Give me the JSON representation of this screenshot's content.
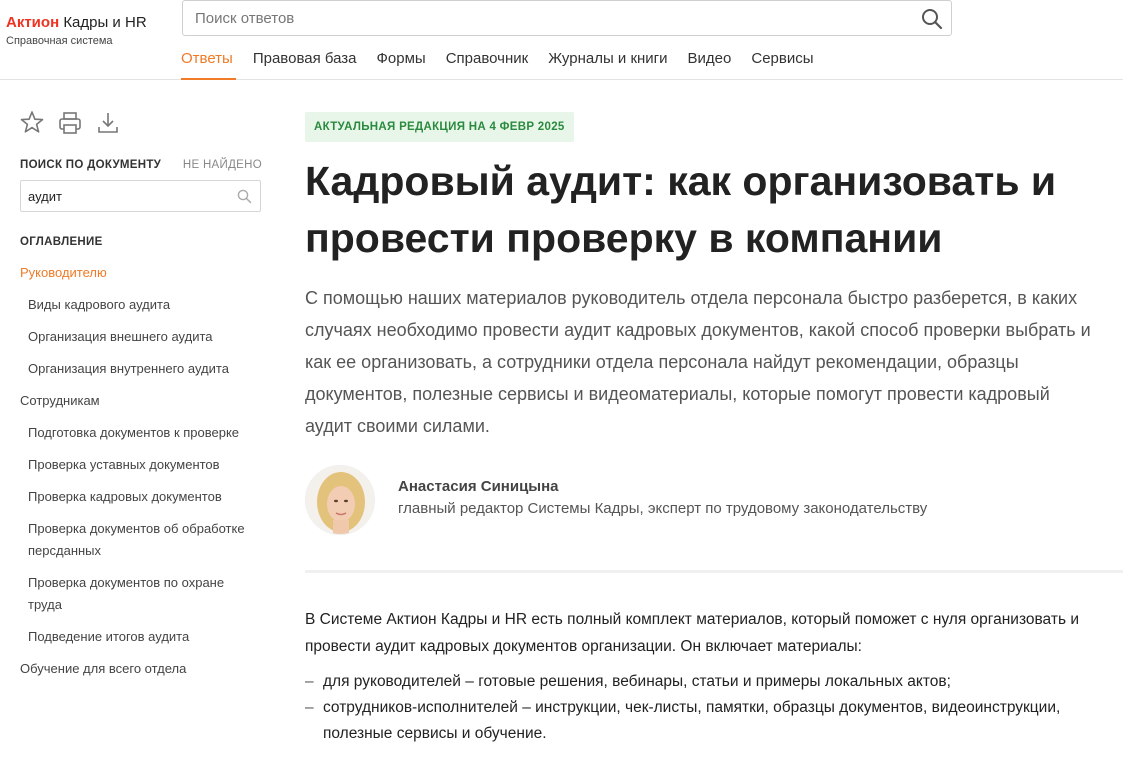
{
  "header": {
    "logo": {
      "brand": "Актион",
      "product": "Кадры и HR",
      "subtitle": "Справочная система"
    },
    "search_placeholder": "Поиск ответов",
    "nav": [
      "Ответы",
      "Правовая база",
      "Формы",
      "Справочник",
      "Журналы и книги",
      "Видео",
      "Сервисы"
    ]
  },
  "sidebar": {
    "doc_search_title": "ПОИСК ПО ДОКУМЕНТУ",
    "not_found": "НЕ НАЙДЕНО",
    "doc_search_value": "аудит",
    "toc_title": "ОГЛАВЛЕНИЕ",
    "toc": [
      {
        "label": "Руководителю",
        "level": 1,
        "active": true
      },
      {
        "label": "Виды кадрового аудита",
        "level": 2
      },
      {
        "label": "Организация внешнего аудита",
        "level": 2
      },
      {
        "label": "Организация внутреннего аудита",
        "level": 2
      },
      {
        "label": "Сотрудникам",
        "level": 1
      },
      {
        "label": "Подготовка документов к проверке",
        "level": 2
      },
      {
        "label": "Проверка уставных документов",
        "level": 2
      },
      {
        "label": "Проверка кадровых документов",
        "level": 2
      },
      {
        "label": "Проверка документов об обработке персданных",
        "level": 2
      },
      {
        "label": "Проверка документов по охране труда",
        "level": 2
      },
      {
        "label": "Подведение итогов аудита",
        "level": 2
      },
      {
        "label": "Обучение для всего отдела",
        "level": 1
      }
    ]
  },
  "main": {
    "badge": "АКТУАЛЬНАЯ РЕДАКЦИЯ НА 4 ФЕВР 2025",
    "title": "Кадровый аудит: как организовать и провести проверку в компании",
    "lead": "С помощью наших материалов руководитель отдела персонала быстро разберется, в каких случаях необходимо провести аудит кадровых документов, какой способ проверки выбрать и как ее организовать, а сотрудники отдела персонала найдут рекомендации, образцы документов, полезные сервисы и видеоматериалы, которые помогут провести кадровый аудит своими силами.",
    "author_name": "Анастасия Синицына",
    "author_role": "главный редактор Системы Кадры, эксперт по трудовому законодательству",
    "body": "В Системе Актион Кадры и HR есть полный комплект материалов, который поможет с нуля организовать и провести аудит кадровых документов организации. Он включает материалы:",
    "list": [
      "для руководителей – готовые решения, вебинары, статьи и примеры локальных актов;",
      "сотрудников-исполнителей – инструкции, чек-листы, памятки, образцы документов, видеоинструкции, полезные сервисы и обучение."
    ]
  },
  "colors": {
    "accent": "#f07a26",
    "brand": "#e32222",
    "badge_bg": "#e8f6ea",
    "badge_text": "#2a8a3e"
  }
}
